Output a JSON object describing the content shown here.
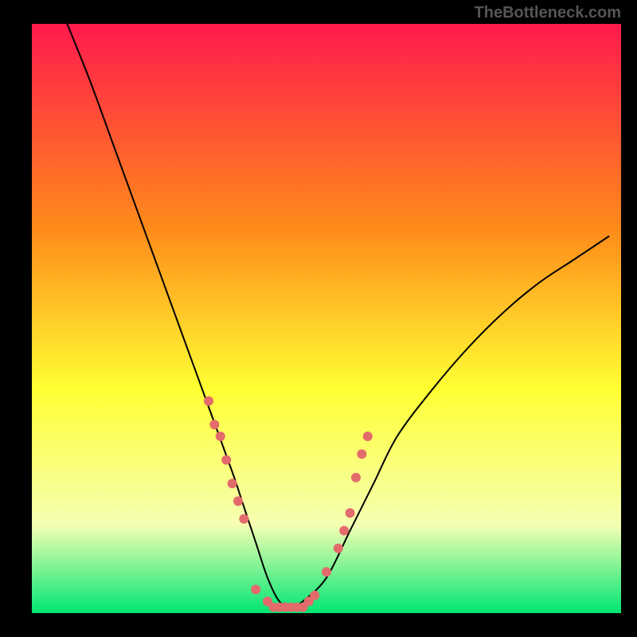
{
  "watermark": "TheBottleneck.com",
  "chart_data": {
    "type": "line",
    "title": "",
    "xlabel": "",
    "ylabel": "",
    "xlim": [
      0,
      100
    ],
    "ylim": [
      0,
      100
    ],
    "background_gradient": {
      "top": "#ff1a4d",
      "mid1": "#ff8c1a",
      "mid2": "#ffff33",
      "mid3": "#f5ffb3",
      "bottom": "#00e673"
    },
    "series": [
      {
        "name": "bottleneck-curve",
        "color": "#000000",
        "x": [
          6,
          10,
          14,
          18,
          22,
          26,
          30,
          34,
          36,
          38,
          40,
          42,
          44,
          46,
          50,
          54,
          58,
          62,
          68,
          74,
          80,
          86,
          92,
          98
        ],
        "y": [
          100,
          90,
          79,
          68,
          57,
          46,
          35,
          24,
          18,
          12,
          6,
          2,
          1,
          2,
          6,
          14,
          22,
          30,
          38,
          45,
          51,
          56,
          60,
          64
        ]
      }
    ],
    "scatter_points": {
      "name": "highlighted-configs",
      "color": "#e36b6b",
      "radius": 6,
      "points": [
        {
          "x": 30,
          "y": 36
        },
        {
          "x": 31,
          "y": 32
        },
        {
          "x": 32,
          "y": 30
        },
        {
          "x": 33,
          "y": 26
        },
        {
          "x": 34,
          "y": 22
        },
        {
          "x": 35,
          "y": 19
        },
        {
          "x": 36,
          "y": 16
        },
        {
          "x": 38,
          "y": 4
        },
        {
          "x": 40,
          "y": 2
        },
        {
          "x": 41,
          "y": 1
        },
        {
          "x": 42,
          "y": 1
        },
        {
          "x": 43,
          "y": 1
        },
        {
          "x": 44,
          "y": 1
        },
        {
          "x": 45,
          "y": 1
        },
        {
          "x": 46,
          "y": 1
        },
        {
          "x": 47,
          "y": 2
        },
        {
          "x": 48,
          "y": 3
        },
        {
          "x": 50,
          "y": 7
        },
        {
          "x": 52,
          "y": 11
        },
        {
          "x": 53,
          "y": 14
        },
        {
          "x": 54,
          "y": 17
        },
        {
          "x": 55,
          "y": 23
        },
        {
          "x": 56,
          "y": 27
        },
        {
          "x": 57,
          "y": 30
        }
      ]
    }
  }
}
